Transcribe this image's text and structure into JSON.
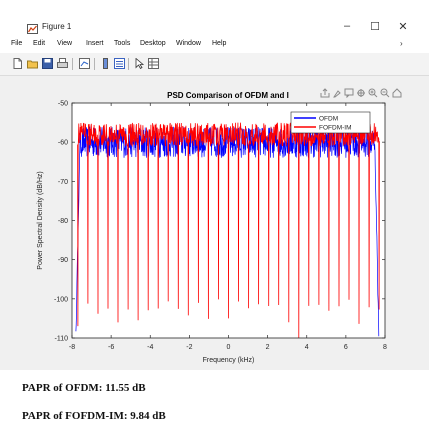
{
  "window": {
    "title": "Figure 1",
    "controls": {
      "minimize": "–",
      "maximize": "☐",
      "close": "✕"
    }
  },
  "menu": [
    "File",
    "Edit",
    "View",
    "Insert",
    "Tools",
    "Desktop",
    "Window",
    "Help"
  ],
  "menu_overflow": "›",
  "toolbar_icons": [
    "new-figure-icon",
    "open-file-icon",
    "save-icon",
    "print-icon",
    "link-plot-icon",
    "insert-colorbar-icon",
    "insert-legend-icon",
    "edit-plot-arrow-icon",
    "property-inspector-icon"
  ],
  "axes_toolbar_icons": [
    "export-icon",
    "brush-icon",
    "data-tips-icon",
    "pan-icon",
    "zoom-in-icon",
    "zoom-out-icon",
    "restore-view-icon"
  ],
  "colors": {
    "ofdm": "#0000ff",
    "fofdm_im": "#ff0000",
    "axes_bg": "#ffffff",
    "figure_bg": "#f0f0f0"
  },
  "chart_data": {
    "type": "line",
    "title": "PSD Comparison of OFDM and I",
    "xlabel": "Frequency (kHz)",
    "ylabel": "Power Spectral Density (dB/Hz)",
    "xlim": [
      -8,
      8
    ],
    "ylim": [
      -110,
      -50
    ],
    "xticks": [
      -8,
      -6,
      -4,
      -2,
      0,
      2,
      4,
      6,
      8
    ],
    "yticks": [
      -50,
      -60,
      -70,
      -80,
      -90,
      -100,
      -110
    ],
    "grid": false,
    "legend_position": "top-right",
    "series": [
      {
        "name": "OFDM",
        "color": "#0000ff",
        "band_kHz": [
          -7.6,
          7.5
        ],
        "level_db": [
          -64,
          -56
        ]
      },
      {
        "name": "FOFDM-IM",
        "color": "#ff0000",
        "band_kHz": [
          -7.7,
          7.7
        ],
        "peak_db": [
          -61,
          -55
        ],
        "null_db": [
          -107,
          -100
        ],
        "deepest_null_db": -110,
        "deepest_null_kHz": 3.6,
        "null_count": 31
      }
    ]
  },
  "results": {
    "papr_ofdm": "PAPR of OFDM: 11.55 dB",
    "papr_fofdm_im": "PAPR of FOFDM-IM: 9.84 dB"
  }
}
